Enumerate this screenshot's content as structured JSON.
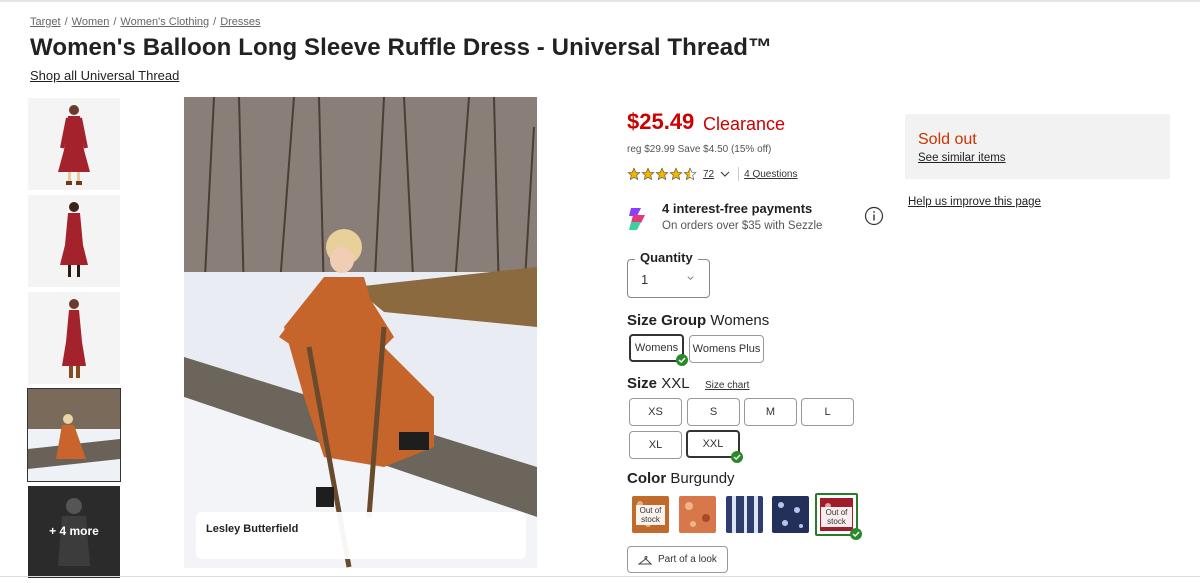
{
  "breadcrumb": [
    "Target",
    "Women",
    "Women's Clothing",
    "Dresses"
  ],
  "product": {
    "title": "Women's Balloon Long Sleeve Ruffle Dress - Universal Thread™",
    "shop_link": "Shop all Universal Thread"
  },
  "gallery": {
    "more_label": "+ 4 more",
    "caption": "Lesley Butterfield"
  },
  "pricing": {
    "price": "$25.49",
    "badge": "Clearance",
    "reg": "reg $29.99 Save $4.50 (15% off)"
  },
  "rating": {
    "value": 4.5,
    "count": "72",
    "questions": "4 Questions"
  },
  "sezzle": {
    "title": "4 interest-free payments",
    "subtitle": "On orders over $35 with Sezzle"
  },
  "quantity": {
    "label": "Quantity",
    "value": "1"
  },
  "size_group": {
    "label": "Size Group",
    "selected": "Womens",
    "options": [
      "Womens",
      "Womens Plus"
    ]
  },
  "size": {
    "label": "Size",
    "selected": "XXL",
    "chart_link": "Size chart",
    "options": [
      "XS",
      "S",
      "M",
      "L",
      "XL",
      "XXL"
    ]
  },
  "color": {
    "label": "Color",
    "selected": "Burgundy",
    "out_of_stock": "Out of stock"
  },
  "look_button": "Part of a look",
  "availability": {
    "status": "Sold out",
    "similar": "See similar items",
    "help": "Help us improve this page"
  },
  "colors": {
    "price": "#cc0000",
    "sold_out": "#cc3300",
    "selected_check": "#2a8a2a"
  }
}
